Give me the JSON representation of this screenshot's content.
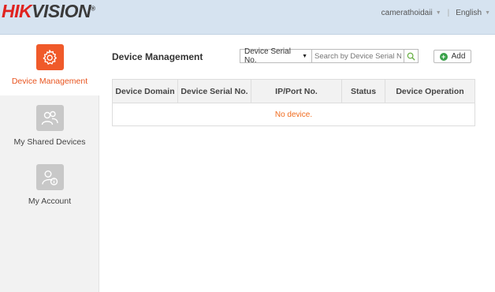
{
  "header": {
    "logo_hik": "HIK",
    "logo_vision": "VISION",
    "logo_reg": "®",
    "username": "camerathoidaii",
    "language": "English"
  },
  "sidebar": {
    "items": [
      {
        "label": "Device Management",
        "icon": "gear-icon",
        "active": true
      },
      {
        "label": "My Shared Devices",
        "icon": "shared-users-icon",
        "active": false
      },
      {
        "label": "My Account",
        "icon": "account-info-icon",
        "active": false
      }
    ]
  },
  "main": {
    "title": "Device Management",
    "search": {
      "select_value": "Device Serial No.",
      "placeholder": "Search by Device Serial No."
    },
    "add_label": "Add",
    "table": {
      "columns": [
        "Device Domain",
        "Device Serial No.",
        "IP/Port No.",
        "Status",
        "Device Operation"
      ],
      "empty_text": "No device."
    }
  },
  "colors": {
    "accent": "#f05a2a",
    "header_bg": "#d6e3f0",
    "empty_text": "#f06b1e"
  }
}
